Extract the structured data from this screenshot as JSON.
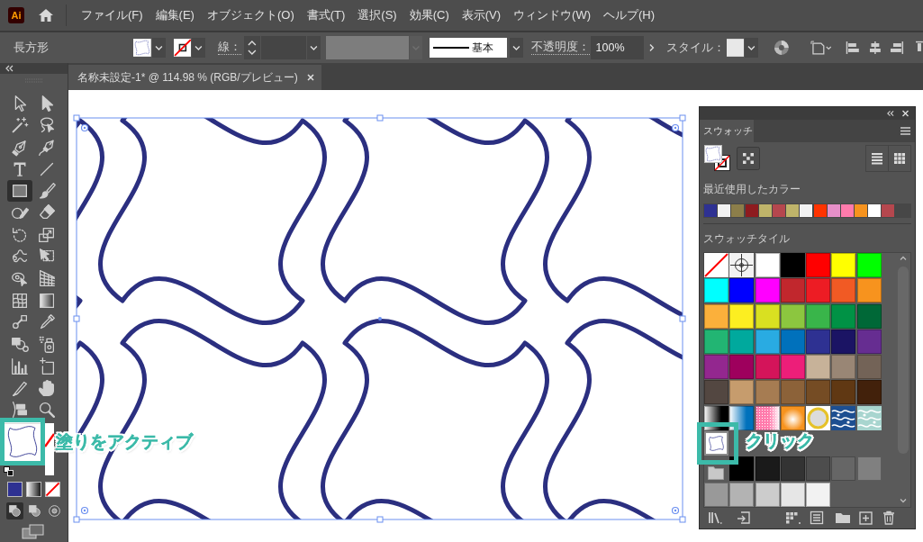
{
  "app_bar": {
    "logo": "Ai",
    "menu": [
      "ファイル(F)",
      "編集(E)",
      "オブジェクト(O)",
      "書式(T)",
      "選択(S)",
      "効果(C)",
      "表示(V)",
      "ウィンドウ(W)",
      "ヘルプ(H)"
    ]
  },
  "control_bar": {
    "object_type": "長方形",
    "stroke_label": "線：",
    "stroke_profile": "基本",
    "opacity_label": "不透明度：",
    "opacity_value": "100%",
    "style_label": "スタイル："
  },
  "document_tab": {
    "title": "名称未設定-1* @ 114.98 % (RGB/プレビュー)"
  },
  "toolbar": {
    "tools": [
      {
        "kind": "selection",
        "selected": false
      },
      {
        "kind": "direct-selection",
        "selected": false
      },
      {
        "kind": "magic-wand",
        "selected": false
      },
      {
        "kind": "lasso",
        "selected": false
      },
      {
        "kind": "pen",
        "selected": false
      },
      {
        "kind": "curvature",
        "selected": false
      },
      {
        "kind": "type",
        "selected": false
      },
      {
        "kind": "line",
        "selected": false
      },
      {
        "kind": "rectangle",
        "selected": true
      },
      {
        "kind": "paintbrush",
        "selected": false
      },
      {
        "kind": "shaper",
        "selected": false
      },
      {
        "kind": "eraser",
        "selected": false
      },
      {
        "kind": "rotate",
        "selected": false
      },
      {
        "kind": "scale",
        "selected": false
      },
      {
        "kind": "warp",
        "selected": false
      },
      {
        "kind": "free-transform",
        "selected": false
      },
      {
        "kind": "shape-builder",
        "selected": false
      },
      {
        "kind": "perspective-grid",
        "selected": false
      },
      {
        "kind": "mesh",
        "selected": false
      },
      {
        "kind": "gradient",
        "selected": false
      },
      {
        "kind": "blend",
        "selected": false
      },
      {
        "kind": "eyedropper",
        "selected": false
      },
      {
        "kind": "live-paint",
        "selected": false
      },
      {
        "kind": "symbol-sprayer",
        "selected": false
      },
      {
        "kind": "graph",
        "selected": false
      },
      {
        "kind": "artboard",
        "selected": false
      },
      {
        "kind": "slice",
        "selected": false
      },
      {
        "kind": "hand",
        "selected": false
      },
      {
        "kind": "puppet-warp",
        "selected": false
      },
      {
        "kind": "zoom",
        "selected": false
      }
    ],
    "draw_modes": [
      {
        "selected": true
      },
      {
        "selected": false
      },
      {
        "selected": false
      }
    ]
  },
  "swatches_panel": {
    "tab": "スウォッチ",
    "recent_label": "最近使用したカラー",
    "recent_colors": [
      {
        "color": "#2e3192"
      },
      {
        "color": "#f2f2f2"
      },
      {
        "color": "#8c7e4a"
      },
      {
        "color": "#8e1b1f"
      },
      {
        "color": "#bfb46a"
      },
      {
        "color": "#b5474e"
      },
      {
        "color": "#bfb46a"
      },
      {
        "color": "#f2f2f2"
      },
      {
        "color": "#ff3300"
      },
      {
        "color": "#e68fc8"
      },
      {
        "color": "#ff7bac"
      },
      {
        "color": "#f7931e"
      },
      {
        "color": "#ffffff"
      },
      {
        "color": "#b5474e"
      }
    ],
    "library_label": "スウォッチタイル",
    "swatch_rows": [
      [
        {
          "kind": "none"
        },
        {
          "kind": "registration"
        },
        {
          "kind": "color",
          "color": "#ffffff"
        },
        {
          "kind": "color",
          "color": "#000000"
        },
        {
          "kind": "color",
          "color": "#ff0000"
        },
        {
          "kind": "color",
          "color": "#ffff00"
        },
        {
          "kind": "color",
          "color": "#00ff00"
        }
      ],
      [
        {
          "kind": "color",
          "color": "#00ffff"
        },
        {
          "kind": "color",
          "color": "#0000ff"
        },
        {
          "kind": "color",
          "color": "#ff00ff"
        },
        {
          "kind": "color",
          "color": "#c1272d"
        },
        {
          "kind": "color",
          "color": "#ed1c24"
        },
        {
          "kind": "color",
          "color": "#f15a24"
        },
        {
          "kind": "color",
          "color": "#f7931e"
        }
      ],
      [
        {
          "kind": "color",
          "color": "#fbb03b"
        },
        {
          "kind": "color",
          "color": "#fcee21"
        },
        {
          "kind": "color",
          "color": "#d9e021"
        },
        {
          "kind": "color",
          "color": "#8cc63f"
        },
        {
          "kind": "color",
          "color": "#39b54a"
        },
        {
          "kind": "color",
          "color": "#009245"
        },
        {
          "kind": "color",
          "color": "#006837"
        }
      ],
      [
        {
          "kind": "color",
          "color": "#22b573"
        },
        {
          "kind": "color",
          "color": "#00a99d"
        },
        {
          "kind": "color",
          "color": "#29abe2"
        },
        {
          "kind": "color",
          "color": "#0071bc"
        },
        {
          "kind": "color",
          "color": "#2e3192"
        },
        {
          "kind": "color",
          "color": "#1b1464"
        },
        {
          "kind": "color",
          "color": "#662d91"
        }
      ],
      [
        {
          "kind": "color",
          "color": "#93278f"
        },
        {
          "kind": "color",
          "color": "#9e005d"
        },
        {
          "kind": "color",
          "color": "#d4145a"
        },
        {
          "kind": "color",
          "color": "#ed1e79"
        },
        {
          "kind": "color",
          "color": "#c7b299"
        },
        {
          "kind": "color",
          "color": "#998675"
        },
        {
          "kind": "color",
          "color": "#736357"
        }
      ],
      [
        {
          "kind": "color",
          "color": "#534741"
        },
        {
          "kind": "color",
          "color": "#c69c6d"
        },
        {
          "kind": "color",
          "color": "#a67c52"
        },
        {
          "kind": "color",
          "color": "#8c6239"
        },
        {
          "kind": "color",
          "color": "#754c24"
        },
        {
          "kind": "color",
          "color": "#603813"
        },
        {
          "kind": "color",
          "color": "#42210b"
        }
      ],
      [
        {
          "kind": "gradient",
          "color": "#000000"
        },
        {
          "kind": "gradient",
          "color": "#0071bc"
        },
        {
          "kind": "dots",
          "color": "#ff7bac"
        },
        {
          "kind": "radial",
          "color": "#f7931e"
        },
        {
          "kind": "ring",
          "color": "#e6c229"
        },
        {
          "kind": "pattern",
          "color": "#1d4f91"
        },
        {
          "kind": "pattern",
          "color": "#a8d5cf"
        }
      ],
      [
        {
          "kind": "tile"
        }
      ],
      [
        {
          "kind": "group"
        },
        {
          "kind": "color",
          "color": "#000000"
        },
        {
          "kind": "color",
          "color": "#1a1a1a"
        },
        {
          "kind": "color",
          "color": "#333333"
        },
        {
          "kind": "color",
          "color": "#4d4d4d"
        },
        {
          "kind": "color",
          "color": "#666666"
        },
        {
          "kind": "color",
          "color": "#808080"
        }
      ],
      [
        {
          "kind": "color",
          "color": "#999999"
        },
        {
          "kind": "color",
          "color": "#b3b3b3"
        },
        {
          "kind": "color",
          "color": "#cccccc"
        },
        {
          "kind": "color",
          "color": "#e6e6e6"
        },
        {
          "kind": "color",
          "color": "#f2f2f2"
        }
      ]
    ]
  },
  "callouts": [
    {
      "text": "塗りをアクティブ"
    },
    {
      "text": "クリック"
    }
  ]
}
